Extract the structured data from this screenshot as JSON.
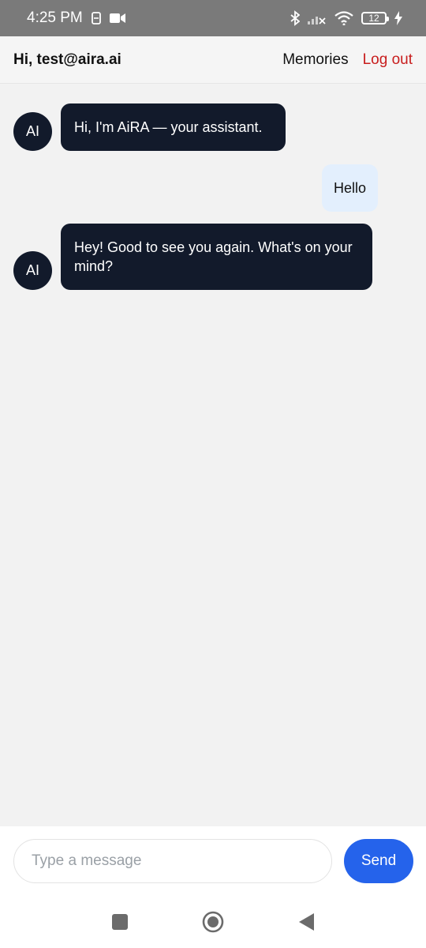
{
  "status_bar": {
    "time": "4:25 PM",
    "battery_level": "12",
    "icons": [
      "sim-icon",
      "video-camera-icon",
      "bluetooth-icon",
      "signal-icon",
      "wifi-icon",
      "battery-icon",
      "charging-icon"
    ]
  },
  "header": {
    "greeting": "Hi, test@aira.ai",
    "memories_label": "Memories",
    "logout_label": "Log out"
  },
  "messages": [
    {
      "sender": "ai",
      "avatar_label": "AI",
      "text": "Hi, I'm AiRA — your assistant."
    },
    {
      "sender": "user",
      "text": "Hello"
    },
    {
      "sender": "ai",
      "avatar_label": "AI",
      "text": "Hey! Good to see you again. What's on your mind?"
    }
  ],
  "composer": {
    "placeholder": "Type a message",
    "value": "",
    "send_label": "Send"
  },
  "nav": {
    "icons": [
      "recents-icon",
      "home-icon",
      "back-icon"
    ]
  },
  "colors": {
    "status_bar_bg": "#7a7a7a",
    "ai_bubble": "#121a2b",
    "user_bubble": "#e3effd",
    "logout": "#c81d1d",
    "send_button": "#2563eb",
    "background": "#f2f2f2"
  }
}
